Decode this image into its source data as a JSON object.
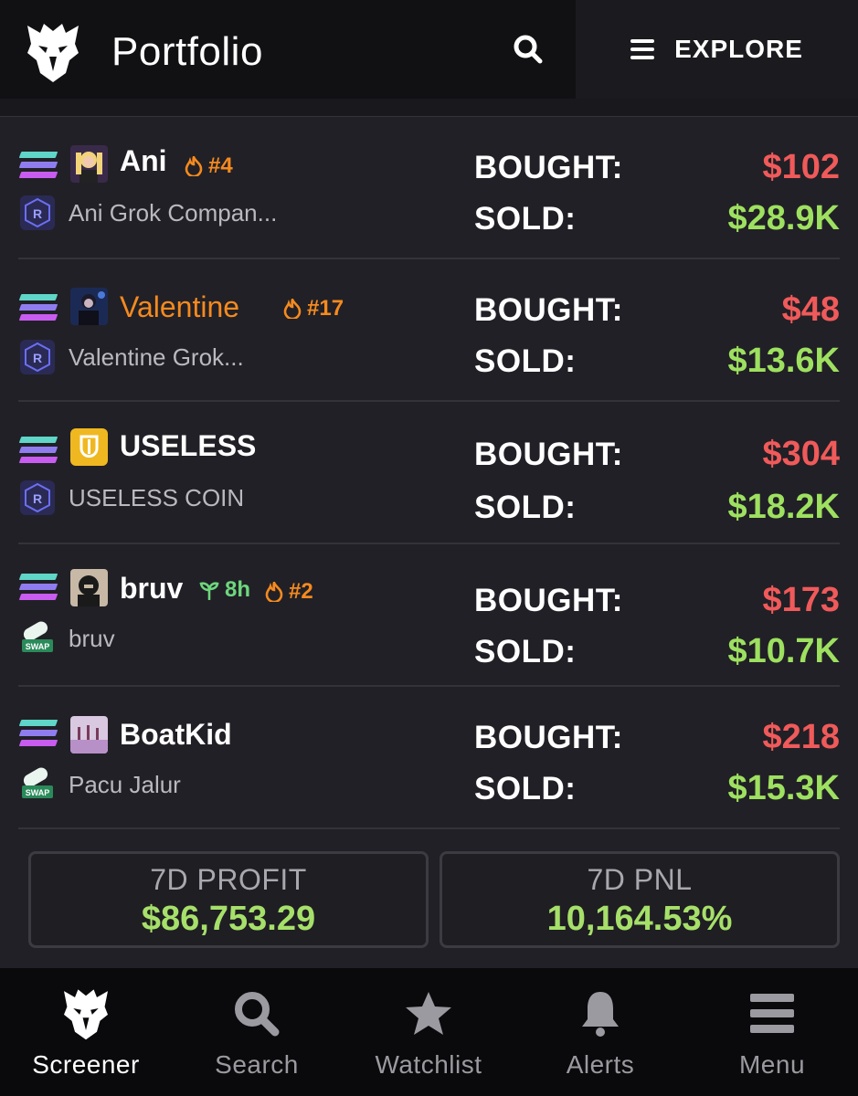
{
  "header": {
    "title": "Portfolio",
    "explore_label": "EXPLORE"
  },
  "rows": [
    {
      "name": "Ani",
      "name_color": "#ffffff",
      "subtitle": "Ani Grok Compan...",
      "rank": "#4",
      "age": "",
      "bought_label": "BOUGHT:",
      "bought": "$102",
      "sold_label": "SOLD:",
      "sold": "$28.9K",
      "dex": "raydium"
    },
    {
      "name": "Valentine",
      "name_color": "#f58a1f",
      "subtitle": "Valentine Grok...",
      "rank": "#17",
      "age": "",
      "bought_label": "BOUGHT:",
      "bought": "$48",
      "sold_label": "SOLD:",
      "sold": "$13.6K",
      "dex": "raydium"
    },
    {
      "name": "USELESS",
      "name_color": "#ffffff",
      "subtitle": "USELESS COIN",
      "rank": "",
      "age": "",
      "bought_label": "BOUGHT:",
      "bought": "$304",
      "sold_label": "SOLD:",
      "sold": "$18.2K",
      "dex": "raydium"
    },
    {
      "name": "bruv",
      "name_color": "#ffffff",
      "subtitle": "bruv",
      "rank": "#2",
      "age": "8h",
      "bought_label": "BOUGHT:",
      "bought": "$173",
      "sold_label": "SOLD:",
      "sold": "$10.7K",
      "dex": "pumpswap"
    },
    {
      "name": "BoatKid",
      "name_color": "#ffffff",
      "subtitle": "Pacu Jalur",
      "rank": "",
      "age": "",
      "bought_label": "BOUGHT:",
      "bought": "$218",
      "sold_label": "SOLD:",
      "sold": "$15.3K",
      "dex": "pumpswap"
    }
  ],
  "dex_icon_text": "SWAP",
  "summary": {
    "profit_label": "7D PROFIT",
    "profit_value": "$86,753.29",
    "pnl_label": "7D PNL",
    "pnl_value": "10,164.53%"
  },
  "nav": [
    {
      "label": "Screener",
      "icon": "eagle-icon",
      "active": true
    },
    {
      "label": "Search",
      "icon": "search-icon",
      "active": false
    },
    {
      "label": "Watchlist",
      "icon": "star-icon",
      "active": false
    },
    {
      "label": "Alerts",
      "icon": "bell-icon",
      "active": false
    },
    {
      "label": "Menu",
      "icon": "menu-icon",
      "active": false
    }
  ],
  "colors": {
    "background": "#212026",
    "header": "#111114",
    "bought": "#f05a5a",
    "sold": "#9ee060",
    "rank": "#f58a1f",
    "age": "#6dd67d"
  }
}
